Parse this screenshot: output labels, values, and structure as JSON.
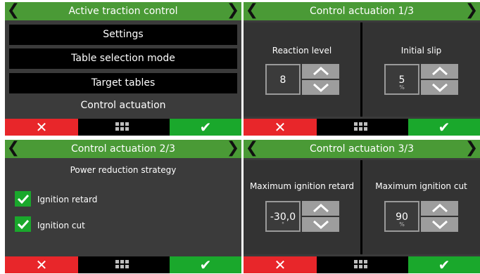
{
  "colors": {
    "header_green": "#4a9a36",
    "cancel_red": "#e8262a",
    "confirm_green": "#1aa82c",
    "screen_bg": "#3b3b3b",
    "arrow_gray": "#9d9d9d"
  },
  "icons": {
    "back": "chevron-left-icon",
    "forward": "chevron-right-icon",
    "cancel": "x-icon",
    "menu": "grid-icon",
    "confirm": "checkmark-icon",
    "increment": "chevron-up-icon",
    "decrement": "chevron-down-icon"
  },
  "screens": [
    {
      "title": "Active traction control",
      "menu": [
        "Settings",
        "Table selection mode",
        "Target tables",
        "Control actuation"
      ]
    },
    {
      "title": "Control actuation 1/3",
      "fields": [
        {
          "label": "Reaction level",
          "value": "8",
          "unit": ""
        },
        {
          "label": "Initial slip",
          "value": "5",
          "unit": "%"
        }
      ]
    },
    {
      "title": "Control actuation 2/3",
      "strategy_label": "Power reduction strategy",
      "options": [
        {
          "label": "Ignition retard",
          "checked": true
        },
        {
          "label": "Ignition cut",
          "checked": true
        }
      ]
    },
    {
      "title": "Control actuation 3/3",
      "fields": [
        {
          "label": "Maximum ignition retard",
          "value": "-30,0",
          "unit": "°"
        },
        {
          "label": "Maximum ignition cut",
          "value": "90",
          "unit": "%"
        }
      ]
    }
  ]
}
